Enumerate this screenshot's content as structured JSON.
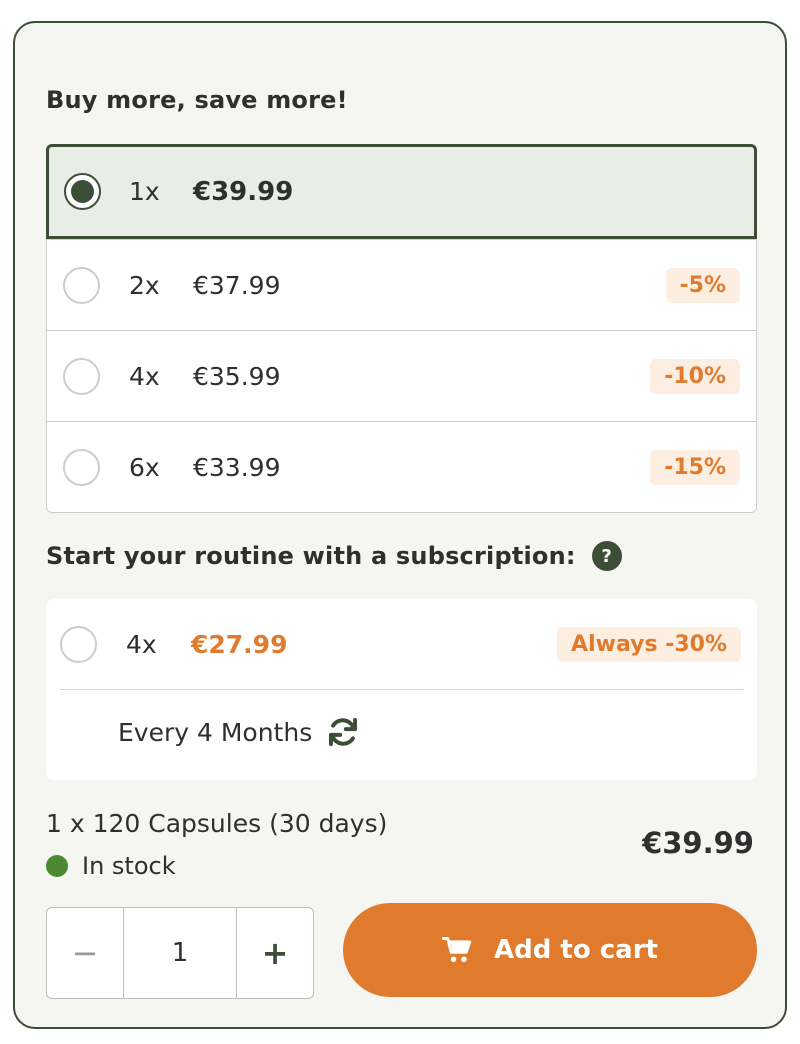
{
  "bulk": {
    "heading": "Buy more, save more!",
    "options": [
      {
        "qty": "1x",
        "price": "€39.99",
        "badge": "",
        "selected": true
      },
      {
        "qty": "2x",
        "price": "€37.99",
        "badge": "-5%",
        "selected": false
      },
      {
        "qty": "4x",
        "price": "€35.99",
        "badge": "-10%",
        "selected": false
      },
      {
        "qty": "6x",
        "price": "€33.99",
        "badge": "-15%",
        "selected": false
      }
    ]
  },
  "subscription": {
    "heading": "Start your routine with a subscription:",
    "help_icon": "?",
    "option": {
      "qty": "4x",
      "price": "€27.99",
      "badge": "Always -30%"
    },
    "frequency": "Every 4 Months"
  },
  "product": {
    "pack": "1 x 120 Capsules (30 days)",
    "stock": "In stock",
    "total": "€39.99"
  },
  "cart": {
    "minus": "−",
    "quantity": "1",
    "plus": "+",
    "add_label": "Add to cart"
  },
  "colors": {
    "accent_green": "#3c4f36",
    "accent_orange": "#e07b2e",
    "stock_green": "#4b8a32"
  }
}
